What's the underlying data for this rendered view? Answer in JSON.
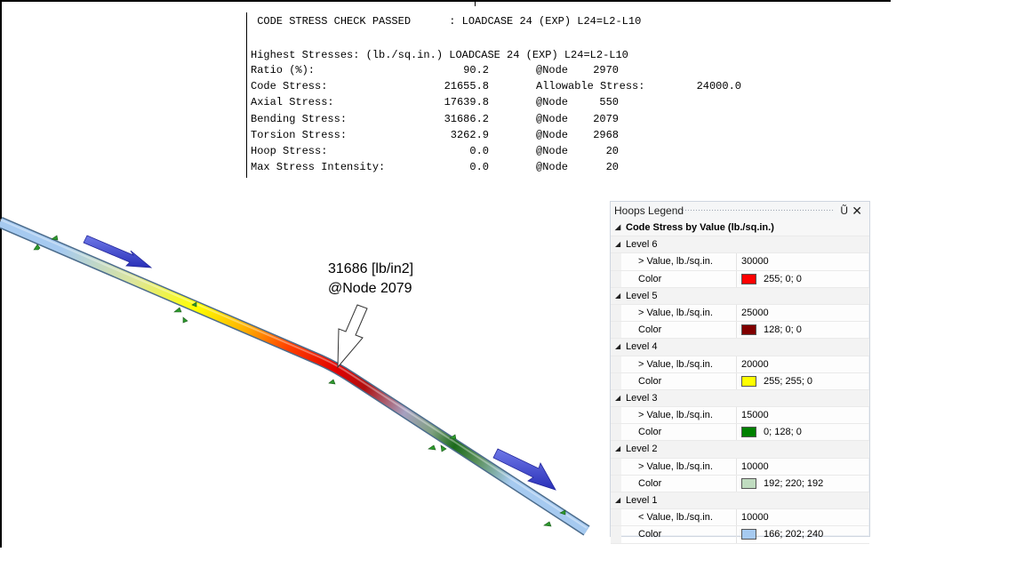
{
  "report": {
    "header": " CODE STRESS CHECK PASSED      : LOADCASE 24 (EXP) L24=L2-L10",
    "subheader": "Highest Stresses: (lb./sq.in.) LOADCASE 24 (EXP) L24=L2-L10",
    "rows": [
      {
        "label": "Ratio (%):",
        "value": "90.2",
        "node_label": "@Node",
        "node": "2970"
      },
      {
        "label": "Code Stress:",
        "value": "21655.8",
        "node_label": "Allowable Stress:",
        "node": "24000.0"
      },
      {
        "label": "Axial Stress:",
        "value": "17639.8",
        "node_label": "@Node",
        "node": "550"
      },
      {
        "label": "Bending Stress:",
        "value": "31686.2",
        "node_label": "@Node",
        "node": "2079"
      },
      {
        "label": "Torsion Stress:",
        "value": "3262.9",
        "node_label": "@Node",
        "node": "2968"
      },
      {
        "label": "Hoop Stress:",
        "value": "0.0",
        "node_label": "@Node",
        "node": "20"
      },
      {
        "label": "Max Stress Intensity:",
        "value": "0.0",
        "node_label": "@Node",
        "node": "20"
      }
    ]
  },
  "annotation": {
    "line1": "31686 [lb/in2]",
    "line2": "@Node 2079"
  },
  "legend": {
    "title": "Hoops Legend",
    "pin_glyph": "Ũ",
    "close_glyph": "✕",
    "header": "Code Stress by Value (lb./sq.in.)",
    "levels": [
      {
        "name": "Level 6",
        "value_label": "> Value, lb./sq.in.",
        "value": "30000",
        "color_label": "Color",
        "color_text": "255; 0; 0",
        "color": "#ff0000"
      },
      {
        "name": "Level 5",
        "value_label": "> Value, lb./sq.in.",
        "value": "25000",
        "color_label": "Color",
        "color_text": "128; 0; 0",
        "color": "#800000"
      },
      {
        "name": "Level 4",
        "value_label": "> Value, lb./sq.in.",
        "value": "20000",
        "color_label": "Color",
        "color_text": "255; 255; 0",
        "color": "#ffff00"
      },
      {
        "name": "Level 3",
        "value_label": "> Value, lb./sq.in.",
        "value": "15000",
        "color_label": "Color",
        "color_text": "0; 128; 0",
        "color": "#008000"
      },
      {
        "name": "Level 2",
        "value_label": "> Value, lb./sq.in.",
        "value": "10000",
        "color_label": "Color",
        "color_text": "192; 220; 192",
        "color": "#c0dcc0"
      },
      {
        "name": "Level 1",
        "value_label": "< Value, lb./sq.in.",
        "value": "10000",
        "color_label": "Color",
        "color_text": "166; 202; 240",
        "color": "#a6caf0"
      }
    ]
  }
}
